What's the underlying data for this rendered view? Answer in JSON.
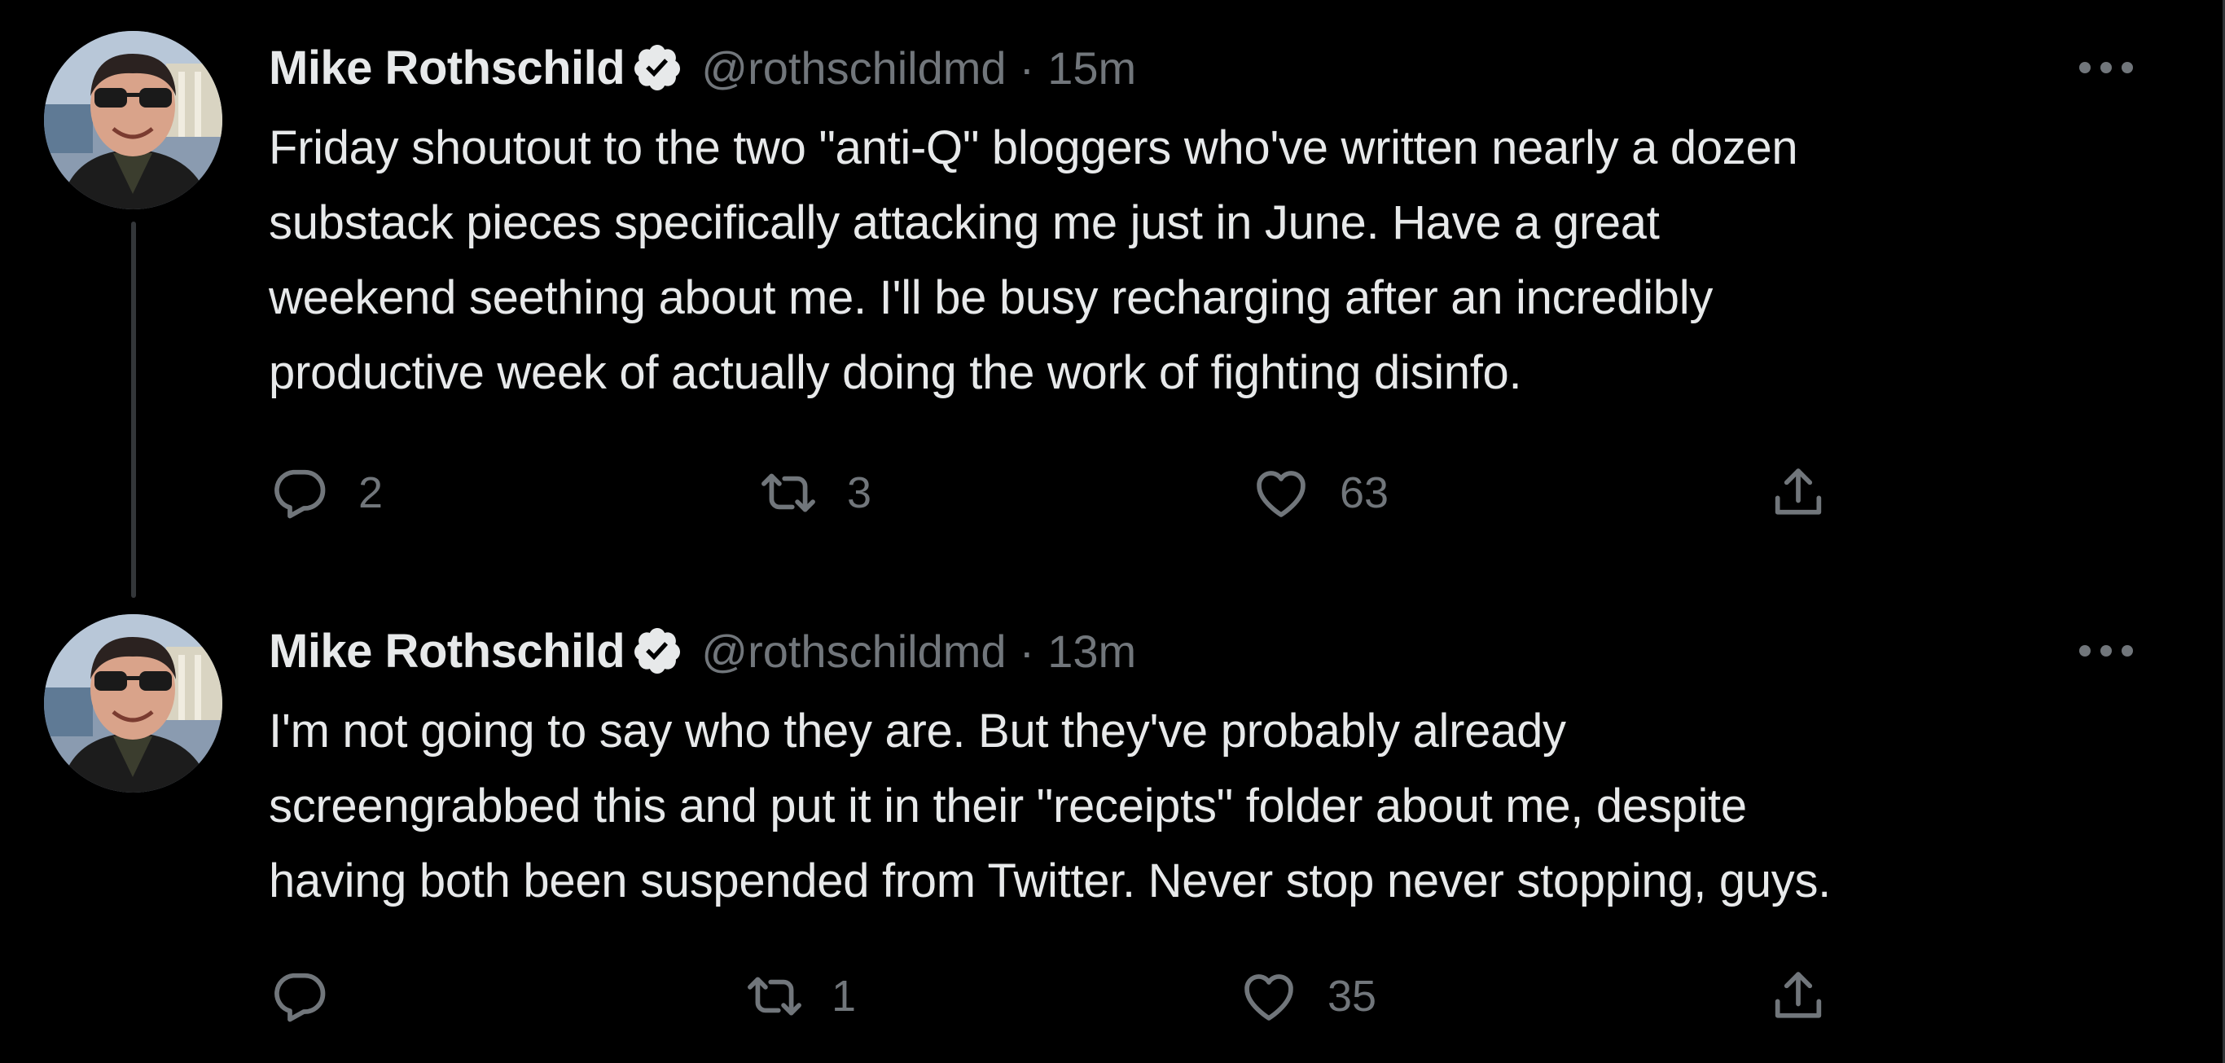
{
  "colors": {
    "background": "#000000",
    "text_primary": "#e7e9ea",
    "text_secondary": "#71767b",
    "thread_line": "#333639",
    "verified_badge": "#e7e9ea"
  },
  "icons": {
    "verified": "verified-badge-icon",
    "more": "more-dots-icon",
    "reply": "reply-icon",
    "retweet": "retweet-icon",
    "like": "heart-icon",
    "share": "share-icon"
  },
  "tweets": [
    {
      "author": {
        "display_name": "Mike Rothschild",
        "handle": "@rothschildmd"
      },
      "separator": "·",
      "time": "15m",
      "text_lines": [
        "Friday shoutout to the two \"anti-Q\" bloggers who've written nearly a dozen",
        "substack pieces specifically attacking me just in June. Have a great",
        "weekend seething about me. I'll be busy recharging after an incredibly",
        "productive week of actually doing the work of fighting disinfo."
      ],
      "stats": {
        "replies": "2",
        "retweets": "3",
        "likes": "63"
      }
    },
    {
      "author": {
        "display_name": "Mike Rothschild",
        "handle": "@rothschildmd"
      },
      "separator": "·",
      "time": "13m",
      "text_lines": [
        "I'm not going to say who they are. But they've probably already",
        "screengrabbed this and put it in their \"receipts\" folder about me, despite",
        "having both been suspended from Twitter. Never stop never stopping, guys."
      ],
      "stats": {
        "replies": "",
        "retweets": "1",
        "likes": "35"
      }
    }
  ]
}
